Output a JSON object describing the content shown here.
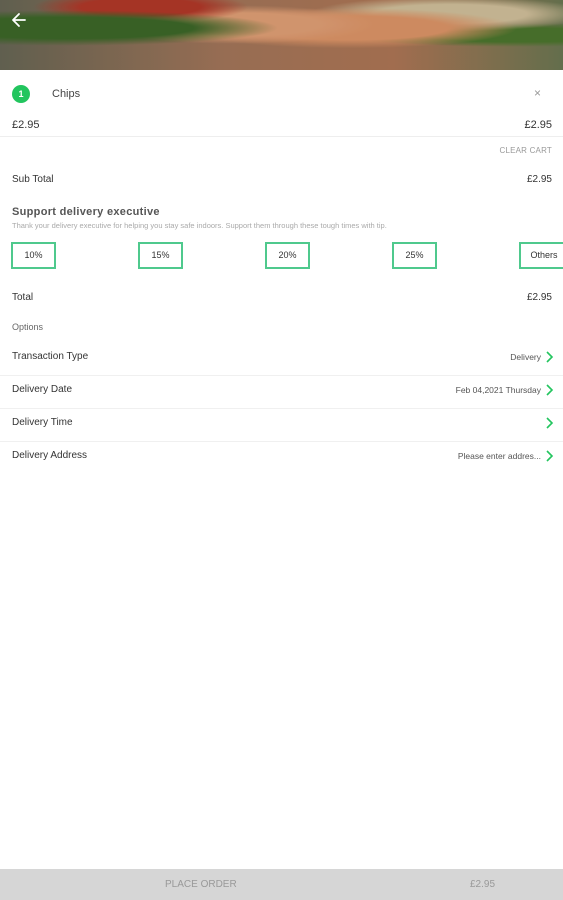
{
  "header": {
    "back_icon": "arrow-left-icon"
  },
  "cart": {
    "item": {
      "quantity": "1",
      "name": "Chips",
      "price": "£2.95",
      "line_total": "£2.95",
      "remove_label": "×"
    },
    "clear_cart_label": "CLEAR CART"
  },
  "summary": {
    "subtotal_label": "Sub Total",
    "subtotal_value": "£2.95",
    "total_label": "Total",
    "total_value": "£2.95"
  },
  "tip": {
    "title": "Support delivery executive",
    "description": "Thank your delivery executive for helping you stay safe indoors. Support them through these tough times with tip.",
    "options": [
      "10%",
      "15%",
      "20%",
      "25%",
      "Others"
    ]
  },
  "options": {
    "label": "Options",
    "rows": [
      {
        "label": "Transaction Type",
        "value": "Delivery"
      },
      {
        "label": "Delivery Date",
        "value": "Feb 04,2021 Thursday"
      },
      {
        "label": "Delivery Time",
        "value": ""
      },
      {
        "label": "Delivery Address",
        "value": "Please enter addres..."
      }
    ]
  },
  "footer": {
    "place_order_label": "PLACE ORDER",
    "total": "£2.95"
  },
  "colors": {
    "accent": "#22c55e",
    "tip_border": "#4fc98d",
    "footer_bg": "#d6d6d6"
  }
}
